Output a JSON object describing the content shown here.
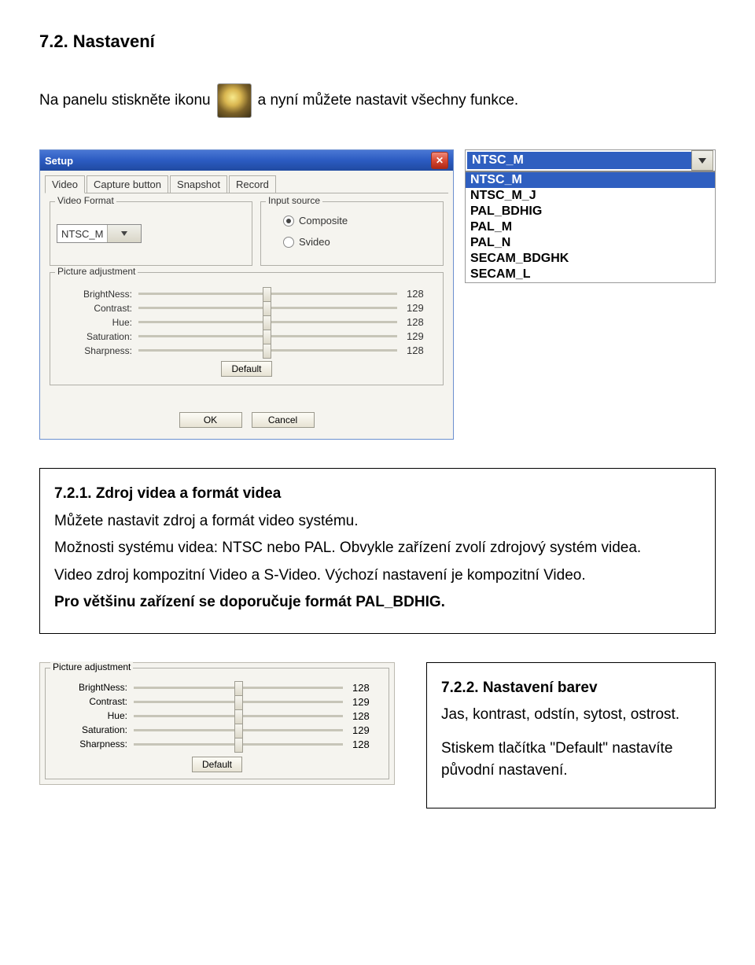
{
  "heading": "7.2. Nastavení",
  "intro": {
    "before": "Na panelu stiskněte ikonu",
    "after": "a nyní můžete nastavit všechny funkce."
  },
  "setup": {
    "title": "Setup",
    "tabs": [
      "Video",
      "Capture button",
      "Snapshot",
      "Record"
    ],
    "activeTab": 0,
    "videoFormat": {
      "legend": "Video Format",
      "selected": "NTSC_M"
    },
    "inputSource": {
      "legend": "Input source",
      "options": [
        "Composite",
        "Svideo"
      ],
      "selected": "Composite"
    },
    "pictureAdjust": {
      "legend": "Picture adjustment",
      "rows": [
        {
          "label": "BrightNess:",
          "value": "128"
        },
        {
          "label": "Contrast:",
          "value": "129"
        },
        {
          "label": "Hue:",
          "value": "128"
        },
        {
          "label": "Saturation:",
          "value": "129"
        },
        {
          "label": "Sharpness:",
          "value": "128"
        }
      ],
      "defaultBtn": "Default"
    },
    "ok": "OK",
    "cancel": "Cancel"
  },
  "dropdownOpen": {
    "selected": "NTSC_M",
    "options": [
      "NTSC_M",
      "NTSC_M_J",
      "PAL_BDHIG",
      "PAL_M",
      "PAL_N",
      "SECAM_BDGHK",
      "SECAM_L"
    ]
  },
  "textbox1": {
    "title": "7.2.1. Zdroj videa a formát videa",
    "p1": "Můžete nastavit zdroj a formát video systému.",
    "p2": "Možnosti systému videa: NTSC nebo PAL. Obvykle zařízení zvolí zdrojový systém videa.",
    "p3": "Video zdroj kompozitní Video a S-Video. Výchozí nastavení je kompozitní Video.",
    "p4": "Pro většinu zařízení se doporučuje formát PAL_BDHIG."
  },
  "picAdjust2": {
    "legend": "Picture adjustment",
    "rows": [
      {
        "label": "BrightNess:",
        "value": "128"
      },
      {
        "label": "Contrast:",
        "value": "129"
      },
      {
        "label": "Hue:",
        "value": "128"
      },
      {
        "label": "Saturation:",
        "value": "129"
      },
      {
        "label": "Sharpness:",
        "value": "128"
      }
    ],
    "defaultBtn": "Default"
  },
  "textbox2": {
    "title": "7.2.2. Nastavení barev",
    "p1": "Jas, kontrast, odstín, sytost, ostrost.",
    "p2": "Stiskem tlačítka \"Default\" nastavíte původní nastavení."
  }
}
